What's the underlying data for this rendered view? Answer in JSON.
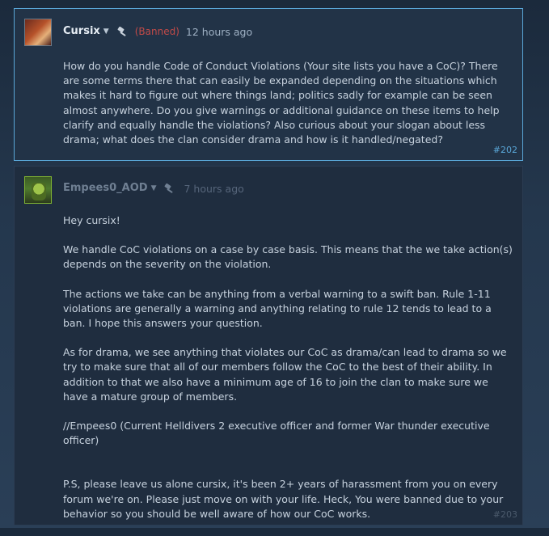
{
  "posts": [
    {
      "author": "Cursix",
      "banned_label": "(Banned)",
      "time": "12 hours ago",
      "paragraphs": [
        "How do you handle Code of Conduct Violations (Your site lists you have a CoC)? There are some terms there that can easily be expanded depending on the situations which makes it hard to figure out where things land; politics sadly for example can be seen almost anywhere. Do you give warnings or additional guidance on these items to help clarify and equally handle the violations? Also curious about your slogan about less drama; what does the clan consider drama and how is it handled/negated?"
      ],
      "number": "#202"
    },
    {
      "author": "Empees0_AOD",
      "time": "7 hours ago",
      "paragraphs": [
        "Hey cursix!",
        "We handle CoC violations on a case by case basis. This means that the we take action(s) depends on the severity on the violation.",
        "The actions we take can be anything from a verbal warning to a swift ban. Rule 1-11 violations are generally a warning and anything relating to rule 12 tends to lead to a ban. I hope this answers your question.",
        "As for drama, we see anything that violates our CoC as drama/can lead to drama so we try to make sure that all of our members follow the CoC to the best of their ability. In addition to that we also have a minimum age of 16 to join the clan to make sure we have a mature group of members.",
        "//Empees0 (Current Helldivers 2 executive officer and former War thunder executive officer)",
        "P.S, please leave us alone cursix, it's been 2+ years of harassment from you on every forum we're on. Please just move on with your life. Heck, You were banned due to your behavior so you should be well aware of how our CoC works."
      ],
      "number": "#203"
    }
  ],
  "colors": {
    "accent": "#5aa7d8",
    "banned": "#c04a48",
    "text": "#c7d2de"
  },
  "icons": {
    "dropdown": "chevron-down-icon",
    "ban": "ban-hammer-icon"
  }
}
